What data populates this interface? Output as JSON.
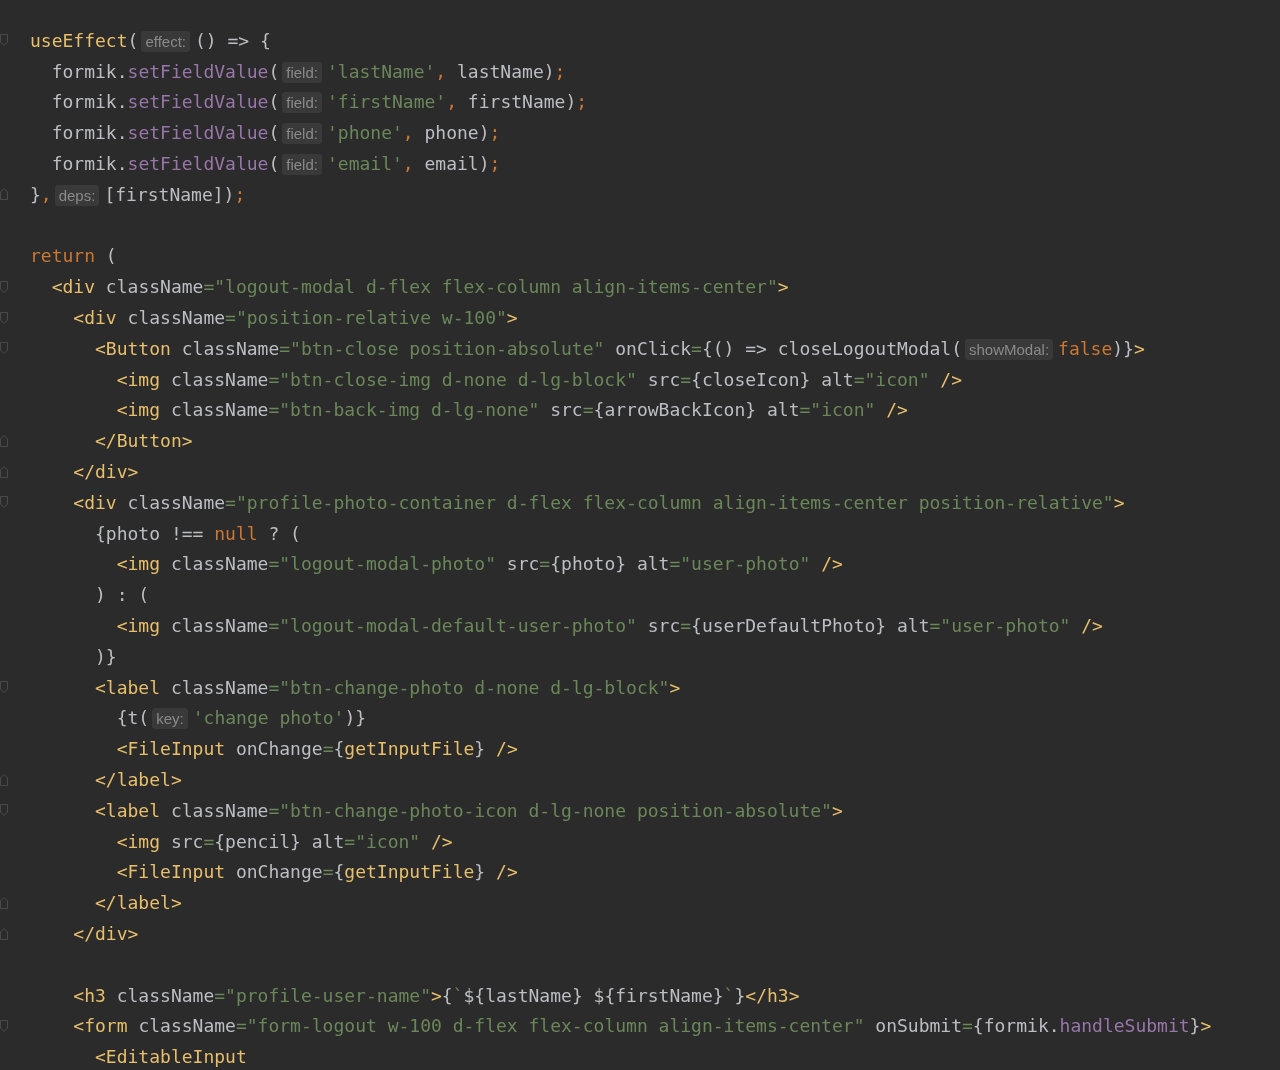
{
  "editor": {
    "lines": [
      {
        "fold_open": true,
        "tokens": [
          {
            "kind": "fn",
            "text": "useEffect"
          },
          {
            "kind": "plain",
            "text": "("
          },
          {
            "kind": "hint",
            "text": "effect:"
          },
          {
            "kind": "plain",
            "text": "() => {"
          }
        ]
      },
      {
        "tokens": [
          {
            "kind": "plain",
            "text": "  formik."
          },
          {
            "kind": "method",
            "text": "setFieldValue"
          },
          {
            "kind": "plain",
            "text": "("
          },
          {
            "kind": "hint",
            "text": "field:"
          },
          {
            "kind": "str",
            "text": "'lastName'"
          },
          {
            "kind": "kw",
            "text": ","
          },
          {
            "kind": "plain",
            "text": " lastName)"
          },
          {
            "kind": "kw",
            "text": ";"
          }
        ]
      },
      {
        "tokens": [
          {
            "kind": "plain",
            "text": "  formik."
          },
          {
            "kind": "method",
            "text": "setFieldValue"
          },
          {
            "kind": "plain",
            "text": "("
          },
          {
            "kind": "hint",
            "text": "field:"
          },
          {
            "kind": "str",
            "text": "'firstName'"
          },
          {
            "kind": "kw",
            "text": ","
          },
          {
            "kind": "plain",
            "text": " firstName)"
          },
          {
            "kind": "kw",
            "text": ";"
          }
        ]
      },
      {
        "tokens": [
          {
            "kind": "plain",
            "text": "  formik."
          },
          {
            "kind": "method",
            "text": "setFieldValue"
          },
          {
            "kind": "plain",
            "text": "("
          },
          {
            "kind": "hint",
            "text": "field:"
          },
          {
            "kind": "str",
            "text": "'phone'"
          },
          {
            "kind": "kw",
            "text": ","
          },
          {
            "kind": "plain",
            "text": " phone)"
          },
          {
            "kind": "kw",
            "text": ";"
          }
        ]
      },
      {
        "tokens": [
          {
            "kind": "plain",
            "text": "  formik."
          },
          {
            "kind": "method",
            "text": "setFieldValue"
          },
          {
            "kind": "plain",
            "text": "("
          },
          {
            "kind": "hint",
            "text": "field:"
          },
          {
            "kind": "str",
            "text": "'email'"
          },
          {
            "kind": "kw",
            "text": ","
          },
          {
            "kind": "plain",
            "text": " email)"
          },
          {
            "kind": "kw",
            "text": ";"
          }
        ]
      },
      {
        "fold_close": true,
        "tokens": [
          {
            "kind": "plain",
            "text": "}"
          },
          {
            "kind": "kw",
            "text": ","
          },
          {
            "kind": "hint",
            "text": "deps:"
          },
          {
            "kind": "plain",
            "text": "[firstName])"
          },
          {
            "kind": "kw",
            "text": ";"
          }
        ]
      },
      {
        "blank_line_before": true,
        "tokens": [
          {
            "kind": "kw",
            "text": "return"
          },
          {
            "kind": "plain",
            "text": " ("
          }
        ]
      },
      {
        "fold_open": true,
        "tokens": [
          {
            "kind": "tag",
            "text": "  <div"
          },
          {
            "kind": "plain",
            "text": " className"
          },
          {
            "kind": "str",
            "text": "=\"logout-modal d-flex flex-column align-items-center\""
          },
          {
            "kind": "tag",
            "text": ">"
          }
        ]
      },
      {
        "fold_open": true,
        "tokens": [
          {
            "kind": "tag",
            "text": "    <div"
          },
          {
            "kind": "plain",
            "text": " className"
          },
          {
            "kind": "str",
            "text": "=\"position-relative w-100\""
          },
          {
            "kind": "tag",
            "text": ">"
          }
        ]
      },
      {
        "fold_open": true,
        "tokens": [
          {
            "kind": "tag",
            "text": "      <Button"
          },
          {
            "kind": "plain",
            "text": " className"
          },
          {
            "kind": "str",
            "text": "=\"btn-close position-absolute\""
          },
          {
            "kind": "plain",
            "text": " onClick"
          },
          {
            "kind": "str",
            "text": "="
          },
          {
            "kind": "plain",
            "text": "{() => closeLogoutModal("
          },
          {
            "kind": "hint",
            "text": "showModal:"
          },
          {
            "kind": "kw",
            "text": "false"
          },
          {
            "kind": "plain",
            "text": ")}"
          },
          {
            "kind": "tag",
            "text": ">"
          }
        ]
      },
      {
        "tokens": [
          {
            "kind": "tag",
            "text": "        <img"
          },
          {
            "kind": "plain",
            "text": " className"
          },
          {
            "kind": "str",
            "text": "=\"btn-close-img d-none d-lg-block\""
          },
          {
            "kind": "plain",
            "text": " src"
          },
          {
            "kind": "str",
            "text": "="
          },
          {
            "kind": "plain",
            "text": "{closeIcon} alt"
          },
          {
            "kind": "str",
            "text": "=\"icon\""
          },
          {
            "kind": "tag",
            "text": " />"
          }
        ]
      },
      {
        "tokens": [
          {
            "kind": "tag",
            "text": "        <img"
          },
          {
            "kind": "plain",
            "text": " className"
          },
          {
            "kind": "str",
            "text": "=\"btn-back-img d-lg-none\""
          },
          {
            "kind": "plain",
            "text": " src"
          },
          {
            "kind": "str",
            "text": "="
          },
          {
            "kind": "plain",
            "text": "{arrowBackIcon} alt"
          },
          {
            "kind": "str",
            "text": "=\"icon\""
          },
          {
            "kind": "tag",
            "text": " />"
          }
        ]
      },
      {
        "fold_close": true,
        "tokens": [
          {
            "kind": "tag",
            "text": "      </Button>"
          }
        ]
      },
      {
        "fold_close": true,
        "tokens": [
          {
            "kind": "tag",
            "text": "    </div>"
          }
        ]
      },
      {
        "fold_open": true,
        "tokens": [
          {
            "kind": "tag",
            "text": "    <div"
          },
          {
            "kind": "plain",
            "text": " className"
          },
          {
            "kind": "str",
            "text": "=\"profile-photo-container d-flex flex-column align-items-center position-relative\""
          },
          {
            "kind": "tag",
            "text": ">"
          }
        ]
      },
      {
        "tokens": [
          {
            "kind": "plain",
            "text": "      {photo !== "
          },
          {
            "kind": "kw",
            "text": "null"
          },
          {
            "kind": "plain",
            "text": " ? ("
          }
        ]
      },
      {
        "tokens": [
          {
            "kind": "tag",
            "text": "        <img"
          },
          {
            "kind": "plain",
            "text": " className"
          },
          {
            "kind": "str",
            "text": "=\"logout-modal-photo\""
          },
          {
            "kind": "plain",
            "text": " src"
          },
          {
            "kind": "str",
            "text": "="
          },
          {
            "kind": "plain",
            "text": "{photo} alt"
          },
          {
            "kind": "str",
            "text": "=\"user-photo\""
          },
          {
            "kind": "tag",
            "text": " />"
          }
        ]
      },
      {
        "tokens": [
          {
            "kind": "plain",
            "text": "      ) : ("
          }
        ]
      },
      {
        "tokens": [
          {
            "kind": "tag",
            "text": "        <img"
          },
          {
            "kind": "plain",
            "text": " className"
          },
          {
            "kind": "str",
            "text": "=\"logout-modal-default-user-photo\""
          },
          {
            "kind": "plain",
            "text": " src"
          },
          {
            "kind": "str",
            "text": "="
          },
          {
            "kind": "plain",
            "text": "{userDefaultPhoto} alt"
          },
          {
            "kind": "str",
            "text": "=\"user-photo\""
          },
          {
            "kind": "tag",
            "text": " />"
          }
        ]
      },
      {
        "tokens": [
          {
            "kind": "plain",
            "text": "      )}"
          }
        ]
      },
      {
        "fold_open": true,
        "tokens": [
          {
            "kind": "tag",
            "text": "      <label"
          },
          {
            "kind": "plain",
            "text": " className"
          },
          {
            "kind": "str",
            "text": "=\"btn-change-photo d-none d-lg-block\""
          },
          {
            "kind": "tag",
            "text": ">"
          }
        ]
      },
      {
        "tokens": [
          {
            "kind": "plain",
            "text": "        {t("
          },
          {
            "kind": "hint",
            "text": "key:"
          },
          {
            "kind": "str",
            "text": "'change photo'"
          },
          {
            "kind": "plain",
            "text": ")}"
          }
        ]
      },
      {
        "tokens": [
          {
            "kind": "tag",
            "text": "        <FileInput"
          },
          {
            "kind": "plain",
            "text": " onChange"
          },
          {
            "kind": "str",
            "text": "="
          },
          {
            "kind": "plain",
            "text": "{"
          },
          {
            "kind": "fn",
            "text": "getInputFile"
          },
          {
            "kind": "plain",
            "text": "}"
          },
          {
            "kind": "tag",
            "text": " />"
          }
        ]
      },
      {
        "fold_close": true,
        "tokens": [
          {
            "kind": "tag",
            "text": "      </label>"
          }
        ]
      },
      {
        "fold_open": true,
        "tokens": [
          {
            "kind": "tag",
            "text": "      <label"
          },
          {
            "kind": "plain",
            "text": " className"
          },
          {
            "kind": "str",
            "text": "=\"btn-change-photo-icon d-lg-none position-absolute\""
          },
          {
            "kind": "tag",
            "text": ">"
          }
        ]
      },
      {
        "tokens": [
          {
            "kind": "tag",
            "text": "        <img"
          },
          {
            "kind": "plain",
            "text": " src"
          },
          {
            "kind": "str",
            "text": "="
          },
          {
            "kind": "plain",
            "text": "{pencil} alt"
          },
          {
            "kind": "str",
            "text": "=\"icon\""
          },
          {
            "kind": "tag",
            "text": " />"
          }
        ]
      },
      {
        "tokens": [
          {
            "kind": "tag",
            "text": "        <FileInput"
          },
          {
            "kind": "plain",
            "text": " onChange"
          },
          {
            "kind": "str",
            "text": "="
          },
          {
            "kind": "plain",
            "text": "{"
          },
          {
            "kind": "fn",
            "text": "getInputFile"
          },
          {
            "kind": "plain",
            "text": "}"
          },
          {
            "kind": "tag",
            "text": " />"
          }
        ]
      },
      {
        "fold_close": true,
        "tokens": [
          {
            "kind": "tag",
            "text": "      </label>"
          }
        ]
      },
      {
        "fold_close": true,
        "tokens": [
          {
            "kind": "tag",
            "text": "    </div>"
          }
        ]
      },
      {
        "blank_line_before": true,
        "tokens": [
          {
            "kind": "tag",
            "text": "    <h3"
          },
          {
            "kind": "plain",
            "text": " className"
          },
          {
            "kind": "str",
            "text": "=\"profile-user-name\""
          },
          {
            "kind": "tag",
            "text": ">"
          },
          {
            "kind": "plain",
            "text": "{"
          },
          {
            "kind": "str",
            "text": "`"
          },
          {
            "kind": "plain",
            "text": "${lastName} ${firstName}"
          },
          {
            "kind": "str",
            "text": "`"
          },
          {
            "kind": "plain",
            "text": "}"
          },
          {
            "kind": "tag",
            "text": "</h3>"
          }
        ]
      },
      {
        "fold_open": true,
        "tokens": [
          {
            "kind": "tag",
            "text": "    <form"
          },
          {
            "kind": "plain",
            "text": " className"
          },
          {
            "kind": "str",
            "text": "=\"form-logout w-100 d-flex flex-column align-items-center\""
          },
          {
            "kind": "plain",
            "text": " onSubmit"
          },
          {
            "kind": "str",
            "text": "="
          },
          {
            "kind": "plain",
            "text": "{formik."
          },
          {
            "kind": "method",
            "text": "handleSubmit"
          },
          {
            "kind": "plain",
            "text": "}"
          },
          {
            "kind": "tag",
            "text": ">"
          }
        ]
      },
      {
        "tokens": [
          {
            "kind": "tag",
            "text": "      <EditableInput"
          }
        ]
      }
    ]
  }
}
